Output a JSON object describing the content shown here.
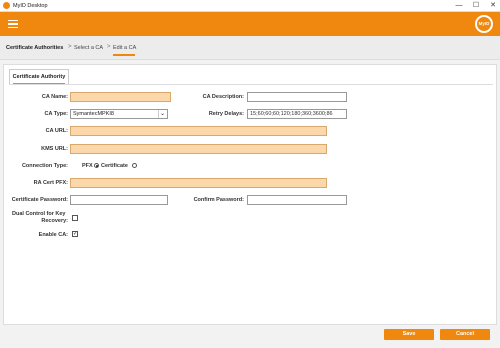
{
  "window": {
    "title": "MyID Desktop",
    "minimize": "—",
    "maximize": "☐",
    "close": "✕"
  },
  "appbar": {
    "logo_text": "MyID",
    "accent_color": "#f0870f"
  },
  "breadcrumb": {
    "root": "Certificate Authorities",
    "step1": "Select a CA",
    "step2": "Edit a CA",
    "separator": ">"
  },
  "tab": {
    "label": "Certificate Authority"
  },
  "form": {
    "ca_name": {
      "label": "CA Name:",
      "value": ""
    },
    "ca_description": {
      "label": "CA Description:",
      "value": ""
    },
    "ca_type": {
      "label": "CA Type:",
      "value": "SymantecMPKI8"
    },
    "retry_delays": {
      "label": "Retry Delays:",
      "value": "15;60;60;60;120;180;360;3600;86"
    },
    "ca_url": {
      "label": "CA URL:",
      "value": ""
    },
    "kms_url": {
      "label": "KMS URL:",
      "value": ""
    },
    "connection_type": {
      "label": "Connection Type:",
      "option_pfx": "PFX",
      "option_certificate": "Certificate",
      "selected": "PFX"
    },
    "ra_cert_pfx": {
      "label": "RA Cert PFX:",
      "value": ""
    },
    "certificate_password": {
      "label": "Certificate Password:",
      "value": ""
    },
    "confirm_password": {
      "label": "Confirm Password:",
      "value": ""
    },
    "dual_control_line1": "Dual Control for Key",
    "dual_control_line2": "Recovery:",
    "dual_control_checked": false,
    "enable_ca": {
      "label": "Enable CA:",
      "checked": true,
      "mark": "✓"
    }
  },
  "footer": {
    "save_label": "Save",
    "cancel_label": "Cancel"
  }
}
